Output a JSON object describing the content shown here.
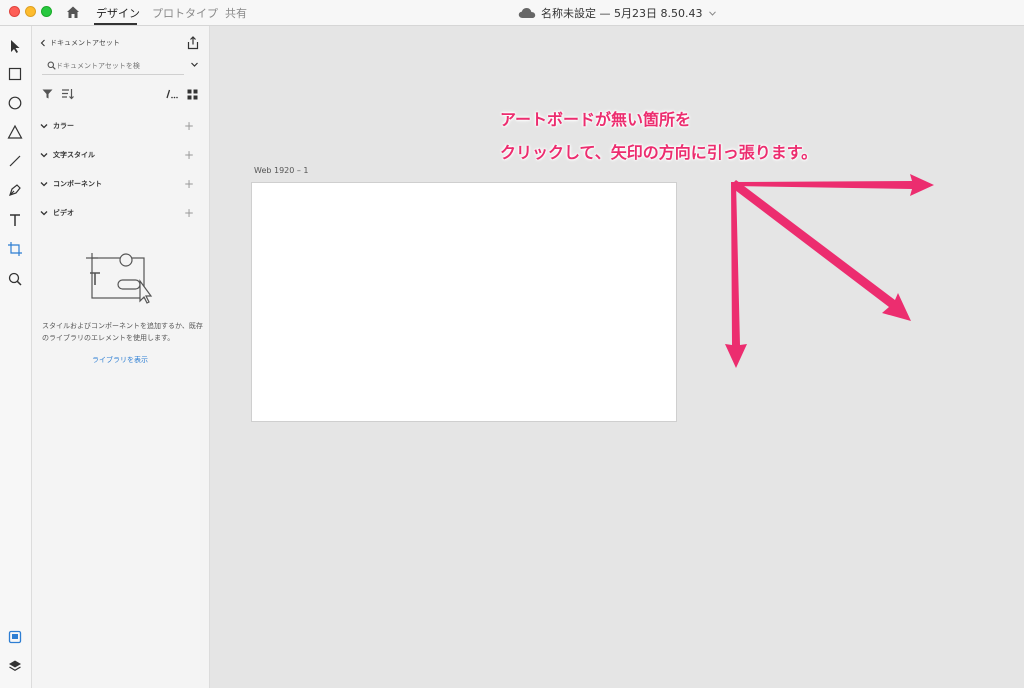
{
  "window": {
    "tabs": [
      {
        "label": "デザイン",
        "active": true
      },
      {
        "label": "プロトタイプ",
        "active": false
      },
      {
        "label": "共有",
        "active": false
      }
    ],
    "document_title": "名称未設定 — 5月23日 8.50.43"
  },
  "tools": [
    "select-tool-icon",
    "rectangle-tool-icon",
    "ellipse-tool-icon",
    "polygon-tool-icon",
    "line-tool-icon",
    "pen-tool-icon",
    "text-tool-icon",
    "artboard-tool-icon",
    "zoom-tool-icon"
  ],
  "assets_panel": {
    "header": "ドキュメントアセット",
    "search_placeholder": "ドキュメントアセットを検",
    "sections": [
      {
        "label": "カラー"
      },
      {
        "label": "文字スタイル"
      },
      {
        "label": "コンポーネント"
      },
      {
        "label": "ビデオ"
      }
    ],
    "empty_text": "スタイルおよびコンポーネントを追加するか、既存のライブラリのエレメントを使用します。",
    "library_link": "ライブラリを表示"
  },
  "canvas": {
    "artboard_label": "Web 1920 – 1",
    "annotation_line1": "アートボードが無い箇所を",
    "annotation_line2": "クリックして、矢印の方向に引っ張ります。",
    "annotation_color": "#ec2d6f"
  },
  "colors": {
    "accent_link": "#2d7ed3",
    "annotation": "#ec2d6f",
    "canvas_bg": "#e5e5e5"
  }
}
